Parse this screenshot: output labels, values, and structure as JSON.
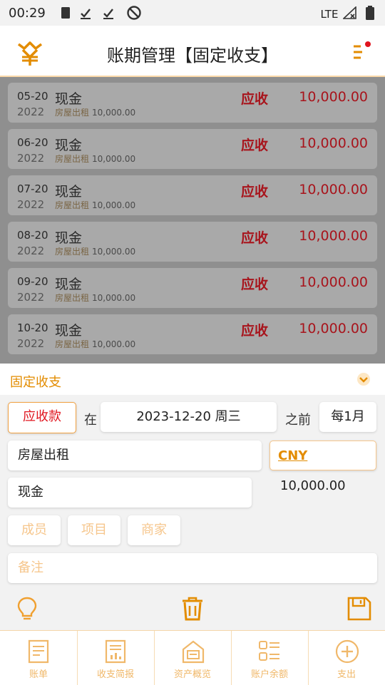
{
  "status_bar": {
    "time": "00:29",
    "network": "LTE"
  },
  "header": {
    "title": "账期管理【固定收支】"
  },
  "list": [
    {
      "md": "05-20",
      "year": "2022",
      "account": "现金",
      "category": "房屋出租",
      "sub_amount": "10,000.00",
      "status": "应收",
      "amount": "10,000.00"
    },
    {
      "md": "06-20",
      "year": "2022",
      "account": "现金",
      "category": "房屋出租",
      "sub_amount": "10,000.00",
      "status": "应收",
      "amount": "10,000.00"
    },
    {
      "md": "07-20",
      "year": "2022",
      "account": "现金",
      "category": "房屋出租",
      "sub_amount": "10,000.00",
      "status": "应收",
      "amount": "10,000.00"
    },
    {
      "md": "08-20",
      "year": "2022",
      "account": "现金",
      "category": "房屋出租",
      "sub_amount": "10,000.00",
      "status": "应收",
      "amount": "10,000.00"
    },
    {
      "md": "09-20",
      "year": "2022",
      "account": "现金",
      "category": "房屋出租",
      "sub_amount": "10,000.00",
      "status": "应收",
      "amount": "10,000.00"
    },
    {
      "md": "10-20",
      "year": "2022",
      "account": "现金",
      "category": "房屋出租",
      "sub_amount": "10,000.00",
      "status": "应收",
      "amount": "10,000.00"
    }
  ],
  "form": {
    "section_title": "固定收支",
    "type_label": "应收款",
    "at_label": "在",
    "date_value": "2023-12-20 周三",
    "before_label": "之前",
    "period_value": "每1月",
    "category_value": "房屋出租",
    "currency": "CNY",
    "amount_value": "10,000.00",
    "account_value": "现金",
    "member_placeholder": "成员",
    "project_placeholder": "项目",
    "merchant_placeholder": "商家",
    "note_placeholder": "备注"
  },
  "nav": {
    "items": [
      {
        "label": "账单",
        "icon": "bill-icon"
      },
      {
        "label": "收支简报",
        "icon": "report-icon"
      },
      {
        "label": "资产概览",
        "icon": "assets-icon"
      },
      {
        "label": "账户余额",
        "icon": "accounts-icon"
      },
      {
        "label": "支出",
        "icon": "add-expense-icon"
      }
    ]
  },
  "colors": {
    "accent": "#e38c00",
    "income_red": "#e0141e",
    "placeholder": "#f6c68c"
  }
}
